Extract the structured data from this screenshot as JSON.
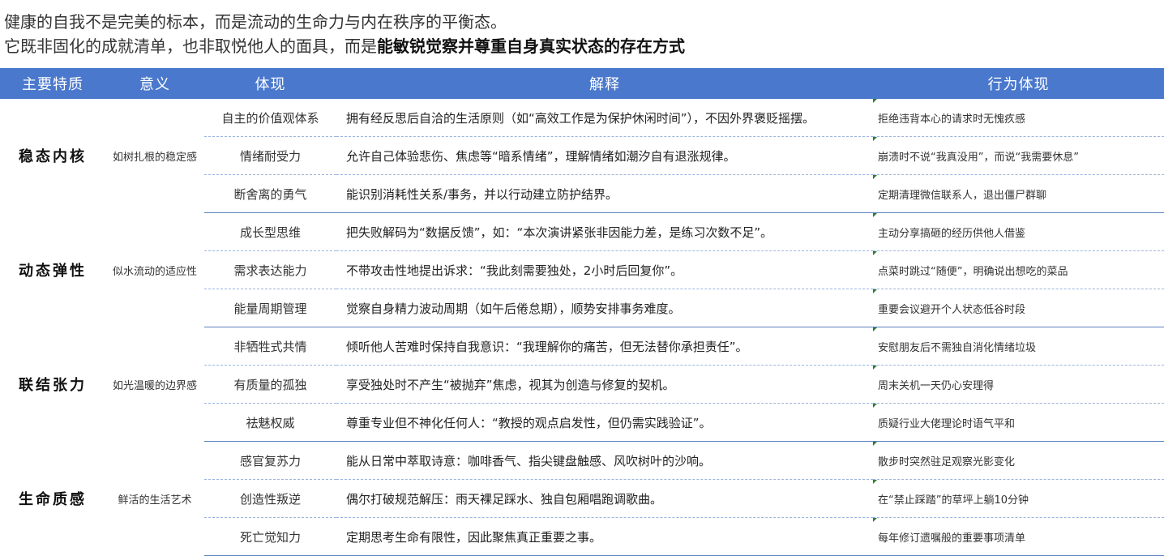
{
  "intro": {
    "line1": "健康的自我不是完美的标本，而是流动的生命力与内在秩序的平衡态。",
    "line2_prefix": "它既非固化的成就清单，也非取悦他人的面具，而是",
    "line2_bold": "能敏锐觉察并尊重自身真实状态的存在方式"
  },
  "table": {
    "headers": [
      "主要特质",
      "意义",
      "体现",
      "解释",
      "行为体现"
    ],
    "groups": [
      {
        "trait": "稳态内核",
        "meaning": "如树扎根的稳定感",
        "rows": [
          {
            "manifestation": "自主的价值观体系",
            "explanation": "拥有经反思后自洽的生活原则（如“高效工作是为保护休闲时间”），不因外界褒贬摇摆。",
            "behavior": "拒绝违背本心的请求时无愧疚感"
          },
          {
            "manifestation": "情绪耐受力",
            "explanation": "允许自己体验悲伤、焦虑等“暗系情绪”，理解情绪如潮汐自有退涨规律。",
            "behavior": "崩溃时不说“我真没用”，而说“我需要休息”"
          },
          {
            "manifestation": "断舍离的勇气",
            "explanation": "能识别消耗性关系/事务，并以行动建立防护结界。",
            "behavior": "定期清理微信联系人，退出僵尸群聊"
          }
        ]
      },
      {
        "trait": "动态弹性",
        "meaning": "似水流动的适应性",
        "rows": [
          {
            "manifestation": "成长型思维",
            "explanation": "把失败解码为“数据反馈”，如：“本次演讲紧张非因能力差，是练习次数不足”。",
            "behavior": "主动分享搞砸的经历供他人借鉴"
          },
          {
            "manifestation": "需求表达能力",
            "explanation": "不带攻击性地提出诉求：“我此刻需要独处，2小时后回复你”。",
            "behavior": "点菜时跳过“随便”，明确说出想吃的菜品"
          },
          {
            "manifestation": "能量周期管理",
            "explanation": "觉察自身精力波动周期（如午后倦怠期），顺势安排事务难度。",
            "behavior": "重要会议避开个人状态低谷时段"
          }
        ]
      },
      {
        "trait": "联结张力",
        "meaning": "如光温暖的边界感",
        "rows": [
          {
            "manifestation": "非牺牲式共情",
            "explanation": "倾听他人苦难时保持自我意识：“我理解你的痛苦，但无法替你承担责任”。",
            "behavior": "安慰朋友后不需独自消化情绪垃圾"
          },
          {
            "manifestation": "有质量的孤独",
            "explanation": "享受独处时不产生“被抛弃”焦虑，视其为创造与修复的契机。",
            "behavior": "周末关机一天仍心安理得"
          },
          {
            "manifestation": "祛魅权威",
            "explanation": "尊重专业但不神化任何人：“教授的观点启发性，但仍需实践验证”。",
            "behavior": "质疑行业大佬理论时语气平和"
          }
        ]
      },
      {
        "trait": "生命质感",
        "meaning": "鲜活的生活艺术",
        "rows": [
          {
            "manifestation": "感官复苏力",
            "explanation": "能从日常中萃取诗意：咖啡香气、指尖键盘触感、风吹树叶的沙响。",
            "behavior": "散步时突然驻足观察光影变化"
          },
          {
            "manifestation": "创造性叛逆",
            "explanation": "偶尔打破规范解压：雨天裸足踩水、独自包厢唱跑调歌曲。",
            "behavior": "在“禁止踩踏”的草坪上躺10分钟"
          },
          {
            "manifestation": "死亡觉知力",
            "explanation": "定期思考生命有限性，因此聚焦真正重要之事。",
            "behavior": "每年修订遗嘱般的重要事项清单"
          }
        ]
      }
    ]
  }
}
